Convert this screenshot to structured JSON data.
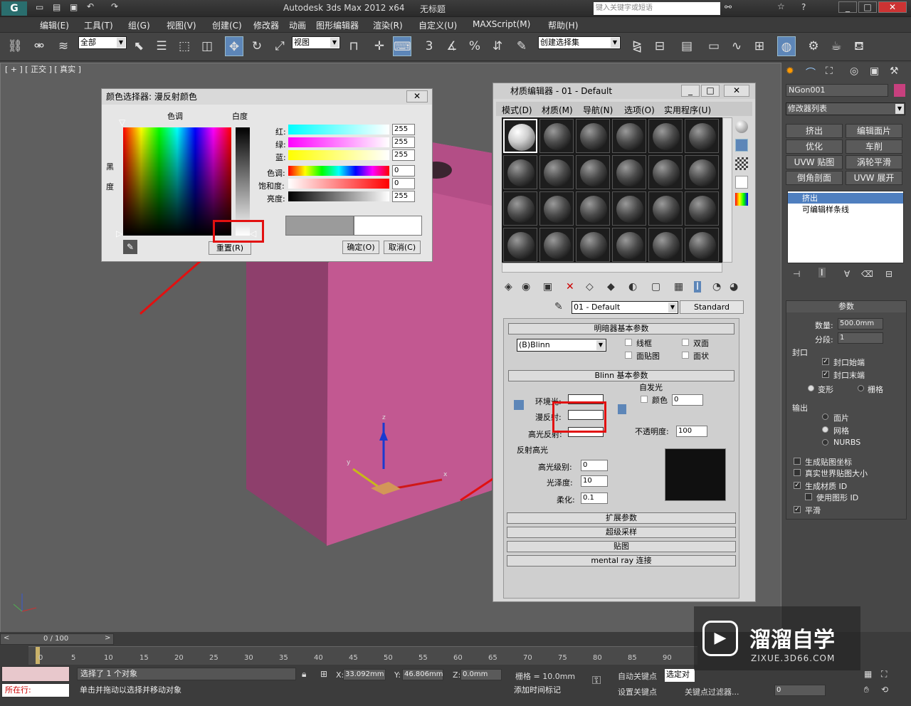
{
  "app": {
    "title": "Autodesk 3ds Max  2012 x64",
    "doc": "无标题",
    "search_placeholder": "键入关键字或短语"
  },
  "menu": [
    "编辑(E)",
    "工具(T)",
    "组(G)",
    "视图(V)",
    "创建(C)",
    "修改器",
    "动画",
    "图形编辑器",
    "渲染(R)",
    "自定义(U)",
    "MAXScript(M)",
    "帮助(H)"
  ],
  "toolbar": {
    "filter": "全部",
    "ref_coord": "视图",
    "selection_set": "创建选择集"
  },
  "viewport": {
    "label": "[ + ] [ 正交 ] [ 真实 ]",
    "axis_x": "x",
    "axis_y": "y",
    "axis_z": "z"
  },
  "color_picker": {
    "title": "颜色选择器: 漫反射颜色",
    "hue_label": "色调",
    "white_label": "白度",
    "black_label": "黑度",
    "red": "红:",
    "green": "绿:",
    "blue": "蓝:",
    "hue": "色调:",
    "sat": "饱和度:",
    "val": "亮度:",
    "red_val": "255",
    "green_val": "255",
    "blue_val": "255",
    "hue_val": "0",
    "sat_val": "0",
    "val_val": "255",
    "reset": "重置(R)",
    "ok": "确定(O)",
    "cancel": "取消(C)"
  },
  "mat_editor": {
    "title": "材质编辑器 - 01 - Default",
    "menu": [
      "模式(D)",
      "材质(M)",
      "导航(N)",
      "选项(O)",
      "实用程序(U)"
    ],
    "material_name": "01 - Default",
    "material_type": "Standard",
    "shader_rollout": "明暗器基本参数",
    "shader": "(B)Blinn",
    "wire": "线框",
    "two_sided": "双面",
    "face_map": "面贴图",
    "faceted": "面状",
    "blinn_rollout": "Blinn 基本参数",
    "self_illum": "自发光",
    "color": "颜色",
    "self_illum_val": "0",
    "ambient": "环境光:",
    "diffuse": "漫反射:",
    "specular": "高光反射:",
    "opacity": "不透明度:",
    "opacity_val": "100",
    "spec_highlights": "反射高光",
    "spec_level": "高光级别:",
    "spec_level_val": "0",
    "glossiness": "光泽度:",
    "glossiness_val": "10",
    "soften": "柔化:",
    "soften_val": "0.1",
    "rollouts": [
      "扩展参数",
      "超级采样",
      "贴图",
      "mental ray 连接"
    ]
  },
  "cmd": {
    "object_name": "NGon001",
    "modifier_list": "修改器列表",
    "buttons": [
      "挤出",
      "编辑面片",
      "优化",
      "车削",
      "UVW 贴图",
      "涡轮平滑",
      "倒角剖面",
      "UVW 展开"
    ],
    "stack": [
      "挤出",
      "可编辑样条线"
    ],
    "params": "参数",
    "amount": "数量:",
    "amount_val": "500.0mm",
    "segments": "分段:",
    "segments_val": "1",
    "capping": "封口",
    "cap_start": "封口始端",
    "cap_end": "封口末端",
    "morph": "变形",
    "grid": "栅格",
    "output": "输出",
    "patch": "面片",
    "mesh": "网格",
    "nurbs": "NURBS",
    "gen_map": "生成贴图坐标",
    "real_world": "真实世界贴图大小",
    "gen_matid": "生成材质 ID",
    "use_shape_id": "使用图形 ID",
    "smooth": "平滑"
  },
  "timeline": {
    "frame": "0 / 100",
    "ticks": [
      "0",
      "5",
      "10",
      "15",
      "20",
      "25",
      "30",
      "35",
      "40",
      "45",
      "50",
      "55",
      "60",
      "65",
      "70",
      "75",
      "80",
      "85",
      "90"
    ]
  },
  "status": {
    "selected": "选择了 1 个对象",
    "hint": "单击并拖动以选择并移动对象",
    "running": "所在行:",
    "x": "33.092mm",
    "y": "46.806mm",
    "z": "0.0mm",
    "grid": "栅格 = 10.0mm",
    "auto_key": "自动关键点",
    "set_key": "设置关键点",
    "selected_btn": "选定对",
    "key_filters": "关键点过滤器...",
    "add_time_tag": "添加时间标记",
    "frame_val": "0"
  },
  "watermark": {
    "brand": "溜溜自学",
    "url": "ZIXUE.3D66.COM"
  },
  "colors": {
    "object": "#c25891",
    "highlight_red": "#e21010",
    "accent": "#5d86b8"
  }
}
